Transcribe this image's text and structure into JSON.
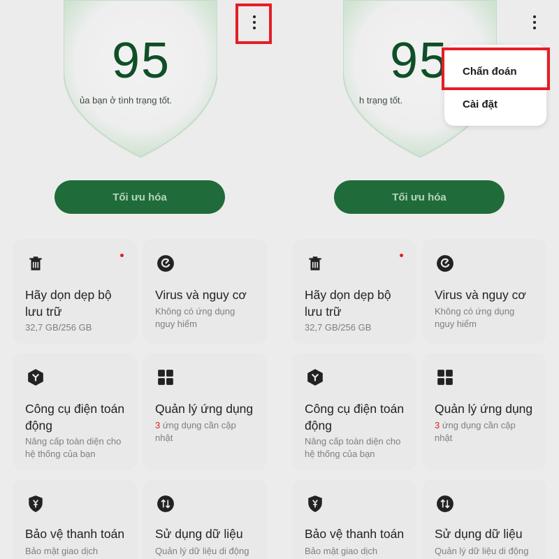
{
  "score": "95",
  "status_text_left": "ủa bạn ở tình trạng tốt.",
  "status_text_right": "h trạng tốt.",
  "optimize_label": "Tối ưu hóa",
  "cards": {
    "storage": {
      "title_1": "Hãy dọn dẹp bộ",
      "title_2": "lưu trữ",
      "sub_1": "32,7 GB/256 GB"
    },
    "virus": {
      "title_1": "Virus và nguy cơ",
      "sub_1": "Không có ứng dụng",
      "sub_2": "nguy hiểm"
    },
    "tools": {
      "title_1": "Công cụ điện toán",
      "title_2": "động",
      "sub_1": "Nâng cấp toàn diện cho",
      "sub_2": "hệ thống của bạn"
    },
    "apps": {
      "title_1": "Quản lý ứng dụng",
      "count": "3",
      "sub_1_rest": " ứng dụng cần cập",
      "sub_2": "nhật"
    },
    "payment": {
      "title_1": "Bảo vệ thanh toán",
      "sub_1": "Bảo mật giao dịch"
    },
    "data": {
      "title_1": "Sử dụng dữ liệu",
      "sub_1": "Quản lý dữ liệu di động"
    }
  },
  "menu": {
    "diagnose": "Chẩn đoán",
    "settings": "Cài đặt"
  },
  "colors": {
    "accent": "#1f6b3a",
    "score": "#0f4f27",
    "highlight": "#e41e26"
  },
  "icons": [
    "more-vert-icon",
    "trash-icon",
    "virus-scan-icon",
    "cube-tool-icon",
    "grid-apps-icon",
    "shield-yen-icon",
    "data-arrows-icon"
  ]
}
